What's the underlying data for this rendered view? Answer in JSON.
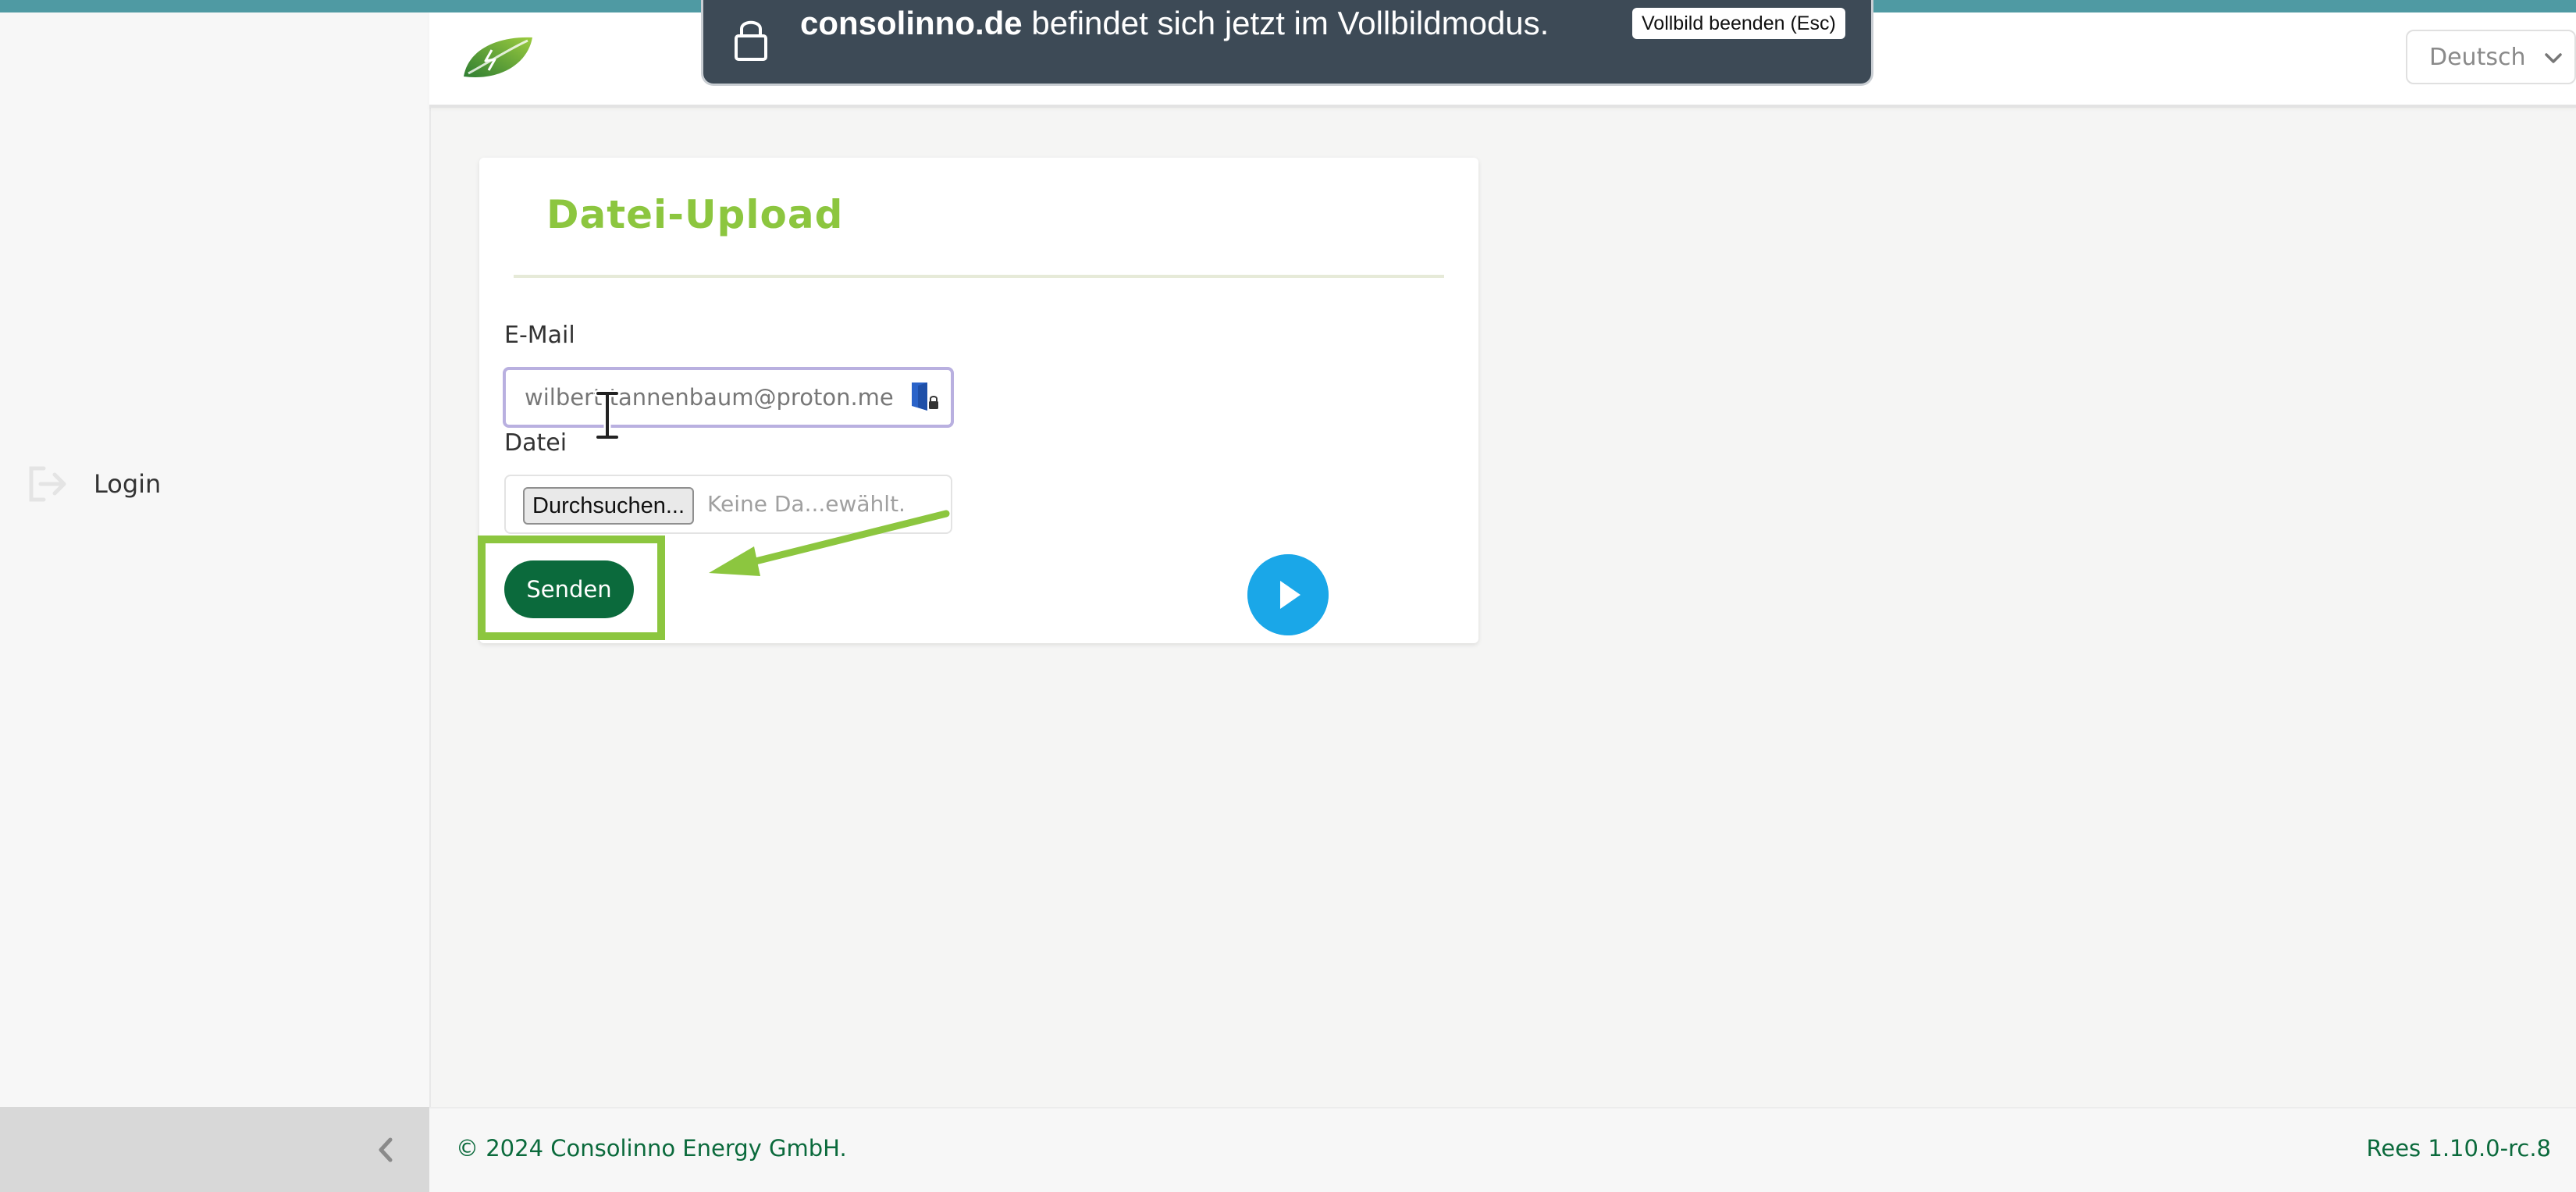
{
  "fullscreen_notice": {
    "domain": "consolinno.de",
    "message": " befindet sich jetzt im Vollbildmodus.",
    "exit_label": "Vollbild beenden (Esc)"
  },
  "header": {
    "language": "Deutsch"
  },
  "sidebar": {
    "login_label": "Login"
  },
  "upload_form": {
    "title": "Datei-Upload",
    "email_label": "E-Mail",
    "email_value": "wilbert.tannenbaum@proton.me",
    "file_label": "Datei",
    "browse_label": "Durchsuchen...",
    "file_status": "Keine Da...ewählt.",
    "submit_label": "Senden"
  },
  "footer": {
    "copyright": "© 2024 Consolinno Energy GmbH.",
    "version": "Rees 1.10.0-rc.8"
  },
  "colors": {
    "brand_green": "#8cc63f",
    "dark_green": "#0b6a3c",
    "play_blue": "#1aa7e8",
    "banner_bg": "#3d4a56"
  },
  "icons": [
    "login-icon",
    "logo-leaf-icon",
    "chevron-down-icon",
    "lock-icon",
    "password-manager-icon",
    "text-cursor-icon",
    "arrow-annotation-icon",
    "play-icon",
    "chevron-left-icon"
  ]
}
